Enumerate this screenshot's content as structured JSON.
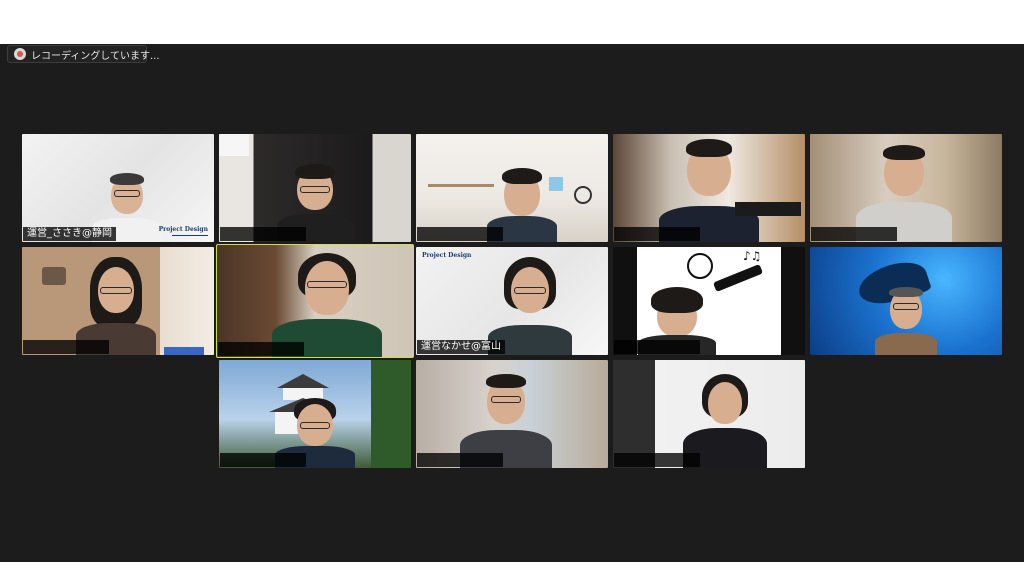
{
  "recording": {
    "icon": "recording-cloud-icon",
    "label": "レコーディングしています..."
  },
  "participants": [
    {
      "name": "運営_ささき@静岡",
      "brand": "Project Design"
    },
    {
      "name": ""
    },
    {
      "name": ""
    },
    {
      "name": ""
    },
    {
      "name": ""
    },
    {
      "name": ""
    },
    {
      "name": "",
      "active": true
    },
    {
      "name": "運営なかせ@富山",
      "brand": "Project Design"
    },
    {
      "name": ""
    },
    {
      "name": ""
    },
    {
      "name": ""
    },
    {
      "name": ""
    },
    {
      "name": ""
    }
  ],
  "colors": {
    "meeting_bg": "#1c1c1c",
    "active_speaker_border": "#c7e34a",
    "recording_dot": "#e0524a"
  }
}
